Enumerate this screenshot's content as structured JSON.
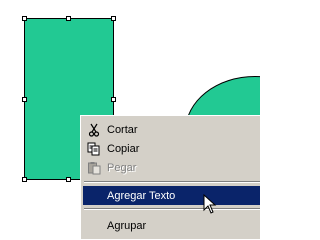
{
  "shapes": {
    "fill_color": "#22c993",
    "rectangle": {
      "selected": true
    },
    "ellipse": {
      "partially_visible": true
    }
  },
  "context_menu": {
    "items": [
      {
        "label": "Cortar",
        "icon": "scissors-icon",
        "enabled": true
      },
      {
        "label": "Copiar",
        "icon": "copy-icon",
        "enabled": true
      },
      {
        "label": "Pegar",
        "icon": "paste-icon",
        "enabled": false
      },
      {
        "label": "Agregar Texto",
        "icon": "",
        "enabled": true,
        "selected": true
      },
      {
        "label": "Agrupar",
        "icon": "",
        "enabled": true
      }
    ],
    "highlight_color": "#0a246a"
  },
  "cursor": {
    "icon": "arrow-cursor-icon"
  }
}
